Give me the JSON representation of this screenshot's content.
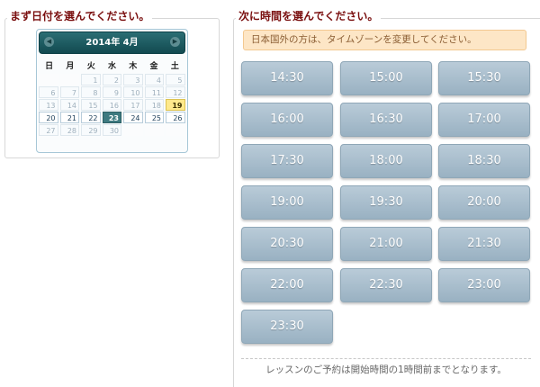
{
  "left": {
    "title": "まず日付を選んでください。"
  },
  "calendar": {
    "prev_icon": "◀",
    "next_icon": "▶",
    "month_title": "2014年 4月",
    "weekdays": [
      "日",
      "月",
      "火",
      "水",
      "木",
      "金",
      "土"
    ],
    "weeks": [
      [
        {
          "label": "",
          "state": "empty"
        },
        {
          "label": "",
          "state": "empty"
        },
        {
          "label": "1",
          "state": "disabled"
        },
        {
          "label": "2",
          "state": "disabled"
        },
        {
          "label": "3",
          "state": "disabled"
        },
        {
          "label": "4",
          "state": "disabled"
        },
        {
          "label": "5",
          "state": "disabled"
        }
      ],
      [
        {
          "label": "6",
          "state": "disabled"
        },
        {
          "label": "7",
          "state": "disabled"
        },
        {
          "label": "8",
          "state": "disabled"
        },
        {
          "label": "9",
          "state": "disabled"
        },
        {
          "label": "10",
          "state": "disabled"
        },
        {
          "label": "11",
          "state": "disabled"
        },
        {
          "label": "12",
          "state": "disabled"
        }
      ],
      [
        {
          "label": "13",
          "state": "disabled"
        },
        {
          "label": "14",
          "state": "disabled"
        },
        {
          "label": "15",
          "state": "disabled"
        },
        {
          "label": "16",
          "state": "disabled"
        },
        {
          "label": "17",
          "state": "disabled"
        },
        {
          "label": "18",
          "state": "disabled"
        },
        {
          "label": "19",
          "state": "today"
        }
      ],
      [
        {
          "label": "20",
          "state": "available"
        },
        {
          "label": "21",
          "state": "available"
        },
        {
          "label": "22",
          "state": "available"
        },
        {
          "label": "23",
          "state": "selected"
        },
        {
          "label": "24",
          "state": "available"
        },
        {
          "label": "25",
          "state": "available"
        },
        {
          "label": "26",
          "state": "available"
        }
      ],
      [
        {
          "label": "27",
          "state": "disabled"
        },
        {
          "label": "28",
          "state": "disabled"
        },
        {
          "label": "29",
          "state": "disabled"
        },
        {
          "label": "30",
          "state": "disabled"
        },
        {
          "label": "",
          "state": "empty"
        },
        {
          "label": "",
          "state": "empty"
        },
        {
          "label": "",
          "state": "empty"
        }
      ]
    ]
  },
  "right": {
    "title": "次に時間を選んでください。",
    "timezone_notice": "日本国外の方は、タイムゾーンを変更してください。",
    "slots": [
      "14:30",
      "15:00",
      "15:30",
      "16:00",
      "16:30",
      "17:00",
      "17:30",
      "18:00",
      "18:30",
      "19:00",
      "19:30",
      "20:00",
      "20:30",
      "21:00",
      "21:30",
      "22:00",
      "22:30",
      "23:00",
      "23:30"
    ],
    "footer_note": "レッスンのご予約は開始時間の1時間前までとなります。"
  },
  "colors": {
    "heading": "#7a0f0f",
    "calendar_header": "#1c5a60",
    "selected_day": "#3e7a80",
    "today_day": "#ffe98c",
    "slot_top": "#b9cbd8",
    "slot_bottom": "#99b1c2",
    "notice_bg": "#fde6c6",
    "notice_text": "#8a5d33"
  }
}
